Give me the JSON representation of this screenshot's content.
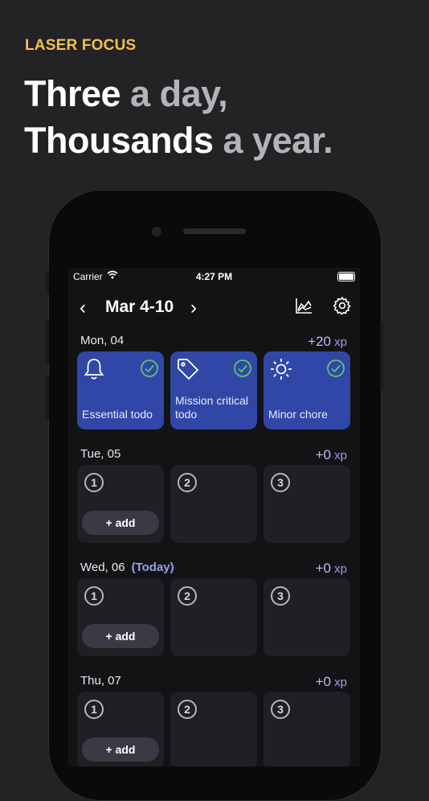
{
  "promo": {
    "tagline": "LASER FOCUS",
    "line1_bold": "Three",
    "line1_light": " a day,",
    "line2_bold": "Thousands",
    "line2_light": " a year."
  },
  "status_bar": {
    "carrier": "Carrier",
    "time": "4:27 PM"
  },
  "nav": {
    "prev_icon": "chevron-left-icon",
    "title": "Mar 4-10",
    "next_icon": "chevron-right-icon",
    "prev_glyph": "‹",
    "next_glyph": "›"
  },
  "days": [
    {
      "label": "Mon, 04",
      "today_label": "",
      "xp_value": "+20",
      "xp_unit": " xp",
      "slots": [
        {
          "number": "1",
          "done": true,
          "icon": "bell-icon",
          "text": "Essential todo"
        },
        {
          "number": "2",
          "done": true,
          "icon": "tag-icon",
          "text": "Mission critical todo"
        },
        {
          "number": "3",
          "done": true,
          "icon": "sun-icon",
          "text": "Minor chore"
        }
      ]
    },
    {
      "label": "Tue, 05",
      "today_label": "",
      "xp_value": "+0",
      "xp_unit": " xp",
      "slots": [
        {
          "number": "1",
          "done": false,
          "add_label": "+ add"
        },
        {
          "number": "2",
          "done": false
        },
        {
          "number": "3",
          "done": false
        }
      ]
    },
    {
      "label": "Wed, 06",
      "today_label": "(Today)",
      "xp_value": "+0",
      "xp_unit": " xp",
      "slots": [
        {
          "number": "1",
          "done": false,
          "add_label": "+ add"
        },
        {
          "number": "2",
          "done": false
        },
        {
          "number": "3",
          "done": false
        }
      ]
    },
    {
      "label": "Thu, 07",
      "today_label": "",
      "xp_value": "+0",
      "xp_unit": " xp",
      "slots": [
        {
          "number": "1",
          "done": false,
          "add_label": "+ add"
        },
        {
          "number": "2",
          "done": false
        },
        {
          "number": "3",
          "done": false
        }
      ]
    }
  ],
  "colors": {
    "tagline": "#f2c14e",
    "done_card": "#3147a8",
    "check": "#5fc36b",
    "xp": "#9aa0e6"
  }
}
